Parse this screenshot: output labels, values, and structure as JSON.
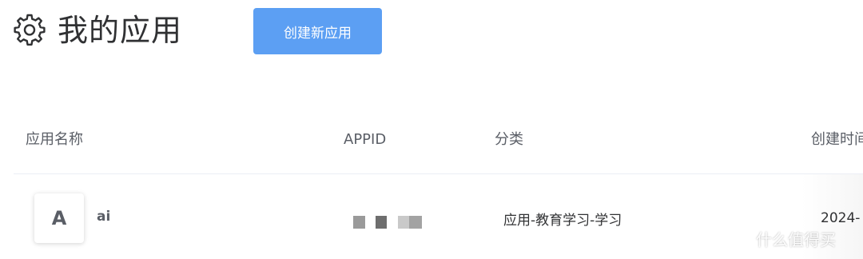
{
  "header": {
    "title": "我的应用",
    "create_button_label": "创建新应用"
  },
  "table": {
    "columns": [
      "应用名称",
      "APPID",
      "分类",
      "创建时间"
    ],
    "rows": [
      {
        "avatar_letter": "A",
        "name": "ai",
        "appid": "",
        "category": "应用-教育学习-学习",
        "created": "2024-"
      }
    ]
  },
  "watermark": {
    "text": "什么值得买"
  },
  "colors": {
    "primary": "#5c9ff3",
    "text": "#303133",
    "muted": "#5a5e66",
    "divider": "#ebeef5"
  },
  "icons": {
    "settings": "gear-icon",
    "watermark": "smzdm-logo-icon"
  }
}
